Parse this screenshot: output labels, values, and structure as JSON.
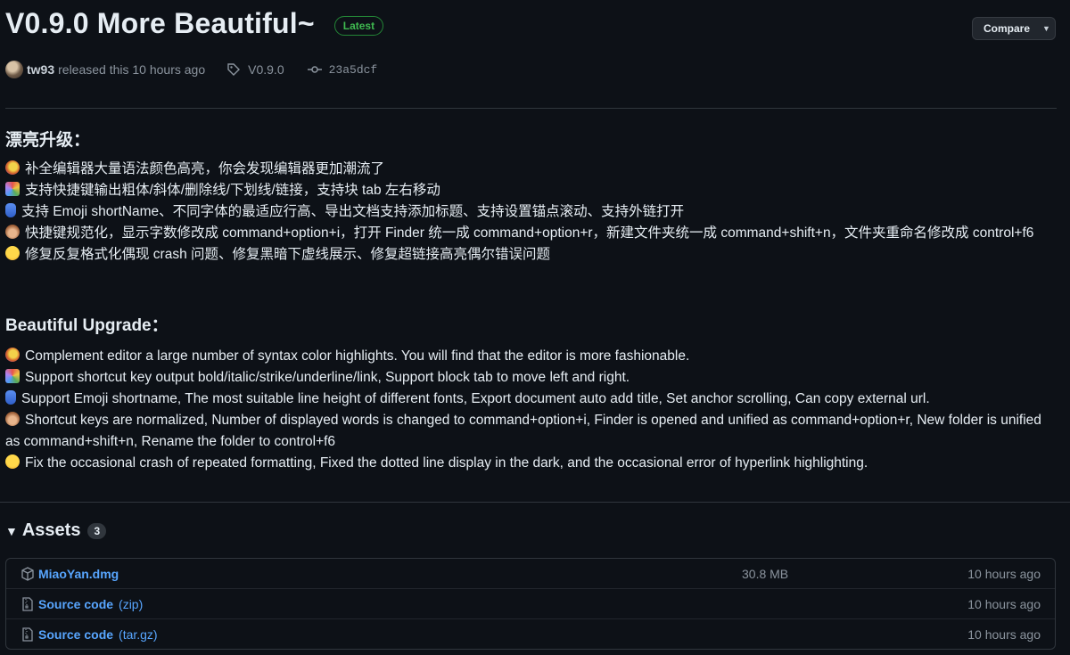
{
  "release": {
    "title": "V0.9.0 More Beautiful~",
    "badge": "Latest",
    "compare_label": "Compare",
    "author": "tw93",
    "released_text": "released this 10 hours ago",
    "tag": "V0.9.0",
    "commit": "23a5dcf"
  },
  "notes_cn": {
    "heading": "漂亮升级：",
    "items": [
      "补全编辑器大量语法颜色高亮，你会发现编辑器更加潮流了",
      "支持快捷键输出粗体/斜体/删除线/下划线/链接，支持块 tab 左右移动",
      "支持 Emoji shortName、不同字体的最适应行高、导出文档支持添加标题、支持设置锚点滚动、支持外链打开",
      "快捷键规范化，显示字数修改成 command+option+i，打开 Finder 统一成 command+option+r，新建文件夹统一成 command+shift+n，文件夹重命名修改成 control+f6",
      "修复反复格式化偶现 crash 问题、修复黑暗下虚线展示、修复超链接高亮偶尔错误问题"
    ]
  },
  "notes_en": {
    "heading": "Beautiful Upgrade：",
    "items": [
      "Complement editor a large number of syntax color highlights. You will find that the editor is more fashionable.",
      "Support shortcut key output bold/italic/strike/underline/link, Support block tab to move left and right.",
      "Support Emoji shortname, The most suitable line height of different fonts, Export document auto add title, Set anchor scrolling, Can copy external url.",
      "Shortcut keys are normalized, Number of displayed words is changed to command+option+i, Finder is opened and unified as command+option+r, New folder is unified as command+shift+n, Rename the folder to control+f6",
      "Fix the occasional crash of repeated formatting, Fixed the dotted line display in the dark, and the occasional error of hyperlink highlighting."
    ]
  },
  "emoji_icons": [
    "lollipop-emoji",
    "party-popper-emoji",
    "phone-emoji",
    "monkey-emoji",
    "grin-emoji"
  ],
  "assets": {
    "heading": "Assets",
    "count": "3",
    "items": [
      {
        "name": "MiaoYan.dmg",
        "ext": "",
        "size": "30.8 MB",
        "time": "10 hours ago",
        "icon": "package-icon"
      },
      {
        "name": "Source code",
        "ext": "(zip)",
        "size": "",
        "time": "10 hours ago",
        "icon": "file-zip-icon"
      },
      {
        "name": "Source code",
        "ext": "(tar.gz)",
        "size": "",
        "time": "10 hours ago",
        "icon": "file-zip-icon"
      }
    ]
  },
  "colors": {
    "background": "#0d1117",
    "link": "#58a6ff",
    "latest_badge": "#3fb950",
    "muted": "#8b949e"
  }
}
